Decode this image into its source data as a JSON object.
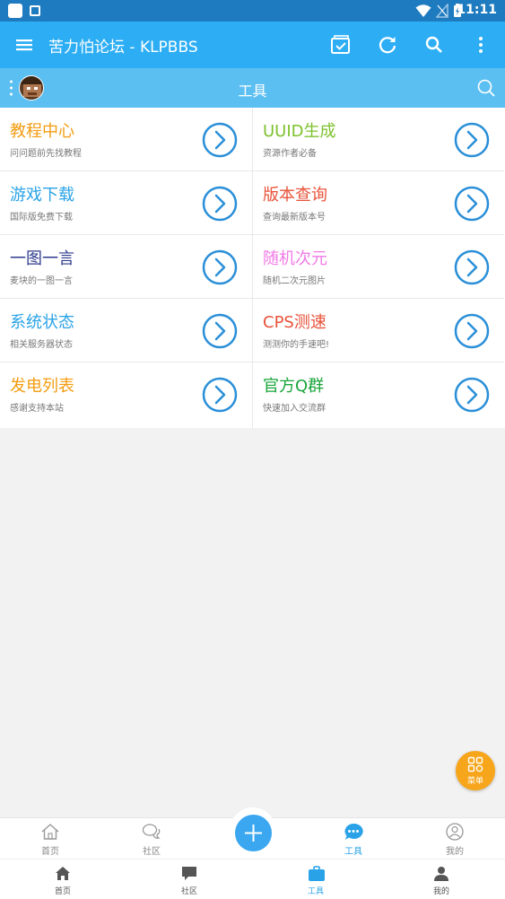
{
  "status_bar": {
    "time": "11:11"
  },
  "app_bar": {
    "title": "苦力怕论坛 - KLPBBS"
  },
  "sub_header": {
    "title": "工具"
  },
  "tools": [
    {
      "title": "教程中心",
      "subtitle": "问问题前先找教程",
      "color": "#f39c12"
    },
    {
      "title": "UUID生成",
      "subtitle": "资源作者必备",
      "color": "#7dc12e"
    },
    {
      "title": "游戏下载",
      "subtitle": "国际版免费下载",
      "color": "#2aa3e6"
    },
    {
      "title": "版本查询",
      "subtitle": "查询最新版本号",
      "color": "#e8533a"
    },
    {
      "title": "一图一言",
      "subtitle": "麦块的一图一言",
      "color": "#2d3a8c"
    },
    {
      "title": "随机次元",
      "subtitle": "随机二次元图片",
      "color": "#f07ae6"
    },
    {
      "title": "系统状态",
      "subtitle": "相关服务器状态",
      "color": "#2aa3e6"
    },
    {
      "title": "CPS测速",
      "subtitle": "测测你的手速吧!",
      "color": "#e8533a"
    },
    {
      "title": "发电列表",
      "subtitle": "感谢支持本站",
      "color": "#f39c12"
    },
    {
      "title": "官方Q群",
      "subtitle": "快速加入交流群",
      "color": "#19a53a"
    }
  ],
  "fab_menu": {
    "label": "菜单"
  },
  "bottom_nav_primary": [
    {
      "label": "首页"
    },
    {
      "label": "社区"
    },
    {
      "label": "工具"
    },
    {
      "label": "我的"
    }
  ],
  "bottom_nav_secondary": [
    {
      "label": "首页"
    },
    {
      "label": "社区"
    },
    {
      "label": "工具"
    },
    {
      "label": "我的"
    }
  ],
  "colors": {
    "primary": "#2daef4",
    "sub_header": "#5cbff2",
    "accent_active": "#29a2e8",
    "arrow": "#2a8fd8",
    "fab": "#f7a51a"
  }
}
